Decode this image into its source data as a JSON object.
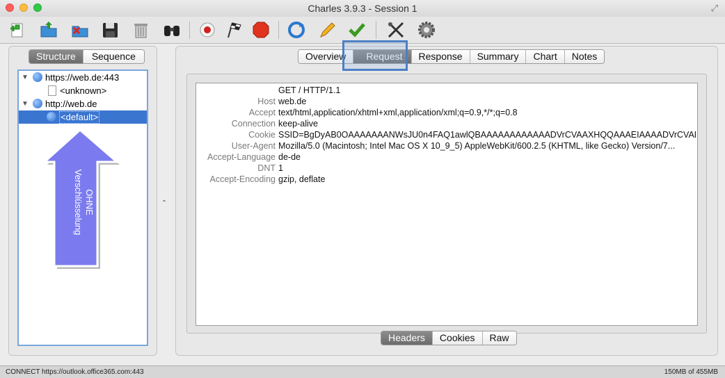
{
  "window": {
    "title": "Charles 3.9.3 - Session 1"
  },
  "toolbar": {
    "buttons": [
      "new-session-icon",
      "open-icon",
      "close-session-icon",
      "save-icon",
      "trash-icon",
      "find-icon",
      "record-icon",
      "throttle-icon",
      "stop-icon",
      "refresh-icon",
      "edit-icon",
      "validate-icon",
      "tools-icon",
      "settings-icon"
    ]
  },
  "left_tabs": [
    "Structure",
    "Sequence"
  ],
  "tree": [
    {
      "label": "https://web.de:443"
    },
    {
      "label": "<unknown>"
    },
    {
      "label": "http://web.de"
    },
    {
      "label": "<default>"
    }
  ],
  "annotation": {
    "line1": "OHNE",
    "line2": "Verschlüsselung",
    "color": "#7b7bef"
  },
  "top_tabs": [
    "Overview",
    "Request",
    "Response",
    "Summary",
    "Chart",
    "Notes"
  ],
  "active_top_tab": "Request",
  "request": {
    "request_line": "GET / HTTP/1.1",
    "headers": [
      {
        "key": "Host",
        "value": "web.de"
      },
      {
        "key": "Accept",
        "value": "text/html,application/xhtml+xml,application/xml;q=0.9,*/*;q=0.8"
      },
      {
        "key": "Connection",
        "value": "keep-alive"
      },
      {
        "key": "Cookie",
        "value": "SSID=BgDyAB0OAAAAAAANWsJU0n4FAQ1awlQBAAAAAAAAAAAADVrCVAAXHQQAAAEIAAAADVrCVAE..."
      },
      {
        "key": "User-Agent",
        "value": "Mozilla/5.0 (Macintosh; Intel Mac OS X 10_9_5) AppleWebKit/600.2.5 (KHTML, like Gecko) Version/7..."
      },
      {
        "key": "Accept-Language",
        "value": "de-de"
      },
      {
        "key": "DNT",
        "value": "1"
      },
      {
        "key": "Accept-Encoding",
        "value": "gzip, deflate"
      }
    ]
  },
  "bottom_tabs": [
    "Headers",
    "Cookies",
    "Raw"
  ],
  "active_bottom_tab": "Headers",
  "status": {
    "left": "CONNECT https://outlook.office365.com:443",
    "right": "150MB of 455MB"
  },
  "split_handle": "ˆ"
}
